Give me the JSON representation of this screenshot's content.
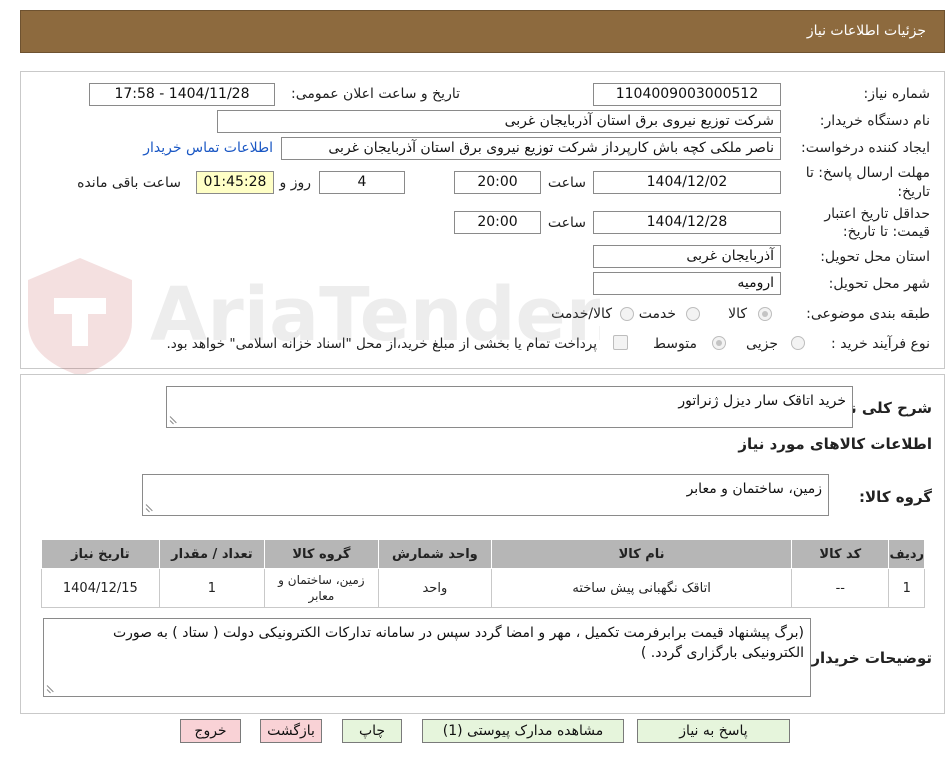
{
  "header": {
    "title": "جزئیات اطلاعات نیاز"
  },
  "form": {
    "need_number": {
      "label": "شماره نیاز:",
      "value": "1104009003000512"
    },
    "announce": {
      "label": "تاریخ و ساعت اعلان عمومی:",
      "value": "1404/11/28 - 17:58"
    },
    "buyer_org": {
      "label": "نام دستگاه خریدار:",
      "value": "شرکت توزیع نیروی برق استان آذربایجان غربی"
    },
    "requester": {
      "label": "ایجاد کننده درخواست:",
      "value": "ناصر ملکی کچه باش کارپرداز شرکت توزیع نیروی برق استان آذربایجان غربی"
    },
    "contact_link": "اطلاعات تماس خریدار",
    "reply_deadline": {
      "label_line1": "مهلت ارسال پاسخ: تا",
      "label_line2": "تاریخ:",
      "date": "1404/12/02",
      "time_label": "ساعت",
      "time": "20:00",
      "days": "4",
      "days_label": "روز و",
      "remaining": "01:45:28",
      "remaining_label": "ساعت باقی مانده"
    },
    "validity": {
      "label_line1": "حداقل تاریخ اعتبار",
      "label_line2": "قیمت: تا تاریخ:",
      "date": "1404/12/28",
      "time_label": "ساعت",
      "time": "20:00"
    },
    "province": {
      "label": "استان محل تحویل:",
      "value": "آذربایجان غربی"
    },
    "city": {
      "label": "شهر محل تحویل:",
      "value": "ارومیه"
    },
    "category": {
      "label": "طبقه بندی موضوعی:",
      "options": [
        "کالا",
        "خدمت",
        "کالا/خدمت"
      ]
    },
    "process": {
      "label": "نوع فرآیند خرید :",
      "options": [
        "جزیی",
        "متوسط"
      ],
      "note": "پرداخت تمام یا بخشی از مبلغ خرید،از محل \"اسناد خزانه اسلامی\" خواهد بود."
    }
  },
  "details": {
    "summary_label": "شرح کلی نیاز:",
    "summary": "خرید اتاقک سار دیزل ژنراتور",
    "goods_info_title": "اطلاعات کالاهای مورد نیاز",
    "group_label": "گروه کالا:",
    "group": "زمین، ساختمان و معابر",
    "table": {
      "headers": [
        "ردیف",
        "کد کالا",
        "نام کالا",
        "واحد شمارش",
        "گروه کالا",
        "تعداد / مقدار",
        "تاریخ نیاز"
      ],
      "rows": [
        [
          "1",
          "--",
          "اتاقک نگهبانی پیش ساخته",
          "واحد",
          "زمین، ساختمان و معابر",
          "1",
          "1404/12/15"
        ]
      ]
    },
    "buyer_notes_label": "توضیحات خریدار:",
    "buyer_notes": "(برگ پیشنهاد قیمت برابرفرمت تکمیل ، مهر و امضا گردد سپس در سامانه تدارکات الکترونیکی دولت ( ستاد ) به صورت الکترونیکی  بارگزاری گردد. )"
  },
  "buttons": {
    "reply": "پاسخ به نیاز",
    "attachments": "مشاهده مدارک پیوستی (1)",
    "print": "چاپ",
    "back": "بازگشت",
    "exit": "خروج"
  },
  "watermark": {
    "text": "AriaTender.neT"
  },
  "colors": {
    "header": "#8d6a3e",
    "link": "#1a57c4",
    "button_green": "#e6f5dc",
    "button_red": "#f9d2d6",
    "table_header": "#b6b6b6"
  }
}
